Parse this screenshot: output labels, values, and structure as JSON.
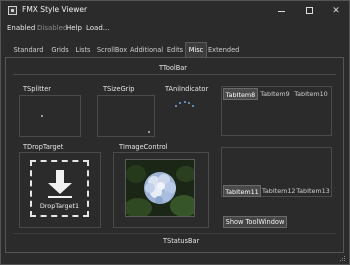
{
  "window": {
    "title": "FMX Style Viewer"
  },
  "window_controls": {
    "minimize": "minimize",
    "maximize": "maximize",
    "close": "✕"
  },
  "menu": [
    "Enabled",
    "Disabled",
    "Help",
    "Load..."
  ],
  "tabs": [
    {
      "label": "Standard",
      "active": false
    },
    {
      "label": "Grids",
      "active": false
    },
    {
      "label": "Lists",
      "active": false
    },
    {
      "label": "ScrollBox",
      "active": false
    },
    {
      "label": "Additional",
      "active": false
    },
    {
      "label": "Edits",
      "active": false
    },
    {
      "label": "Misc",
      "active": true
    },
    {
      "label": "Extended",
      "active": false
    }
  ],
  "misc": {
    "toolbar_label": "TToolBar",
    "splitter_label": "TSplitter",
    "sizegrip_label": "TSizeGrip",
    "aniindicator_label": "TAniIndicator",
    "droptarget_label": "TDropTarget",
    "droptarget_caption": "DropTarget1",
    "imagecontrol_label": "TImageControl",
    "tabcontrol_top": [
      "TabItem8",
      "TabItem9",
      "TabItem10"
    ],
    "tabcontrol_bottom": [
      "TabItem11",
      "TabItem12",
      "TabItem13"
    ],
    "show_toolwindow": "Show ToolWindow",
    "statusbar_label": "TStatusBar"
  },
  "colors": {
    "background": "#2b2b2b",
    "accent_ani": "#6fa8e6",
    "text": "#e6e6e6"
  }
}
